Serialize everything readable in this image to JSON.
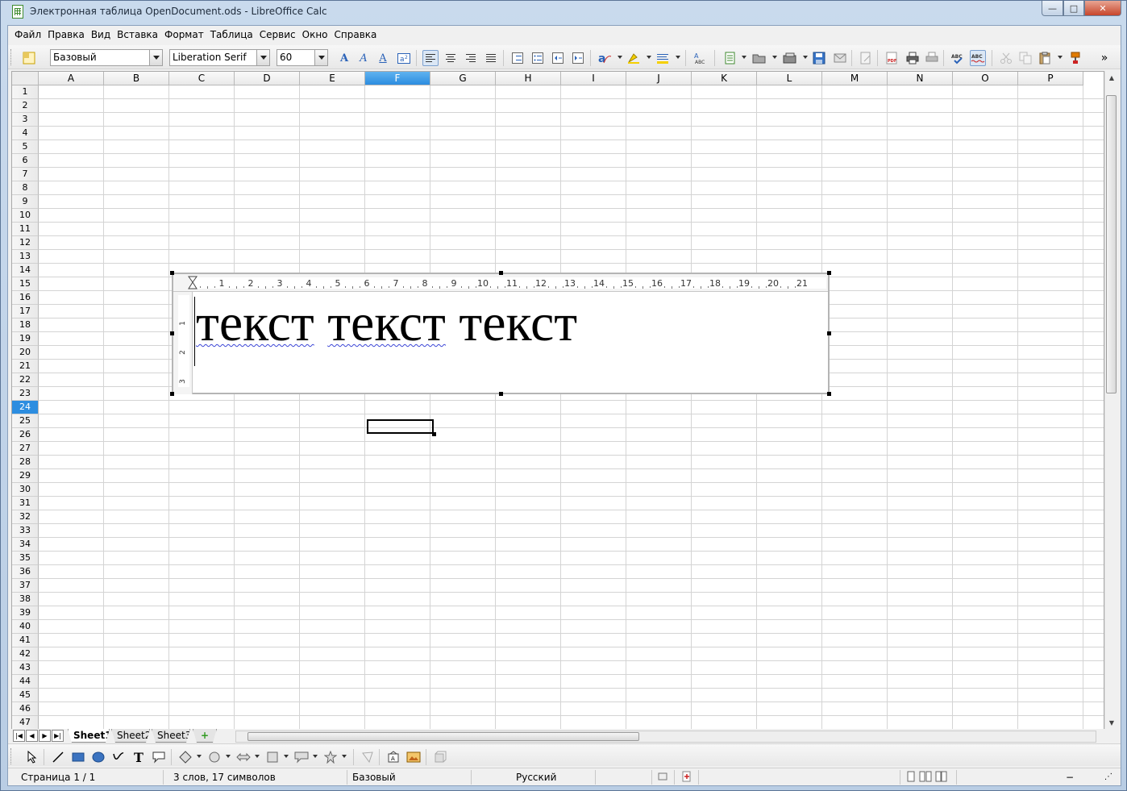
{
  "window": {
    "title": "Электронная таблица OpenDocument.ods - LibreOffice Calc",
    "min_glyph": "—",
    "max_glyph": "□",
    "close_glyph": "✕"
  },
  "menu": [
    "Файл",
    "Правка",
    "Вид",
    "Вставка",
    "Формат",
    "Таблица",
    "Сервис",
    "Окно",
    "Справка"
  ],
  "toolbar": {
    "paragraph_style": "Базовый",
    "font_name": "Liberation Serif",
    "font_size": "60",
    "overflow_glyph": "»"
  },
  "grid": {
    "columns": [
      "A",
      "B",
      "C",
      "D",
      "E",
      "F",
      "G",
      "H",
      "I",
      "J",
      "K",
      "L",
      "M",
      "N",
      "O",
      "P"
    ],
    "selected_column": "F",
    "rows": [
      "1",
      "2",
      "3",
      "4",
      "5",
      "6",
      "7",
      "8",
      "9",
      "10",
      "11",
      "12",
      "13",
      "14",
      "15",
      "16",
      "17",
      "18",
      "19",
      "20",
      "21",
      "22",
      "23",
      "24",
      "25",
      "26",
      "27",
      "28",
      "29",
      "30",
      "31",
      "32",
      "33",
      "34",
      "35",
      "36",
      "37",
      "38",
      "39",
      "40",
      "41",
      "42",
      "43",
      "44",
      "45",
      "46",
      "47"
    ],
    "selected_row": "24"
  },
  "text_frame": {
    "ruler_numbers": [
      "1",
      "2",
      "3",
      "4",
      "5",
      "6",
      "7",
      "8",
      "9",
      "10",
      "11",
      "12",
      "13",
      "14",
      "15",
      "16",
      "17",
      "18",
      "19",
      "20",
      "21"
    ],
    "vertical_ruler_numbers": [
      "1",
      "2",
      "3"
    ],
    "word1": "текст",
    "word2": "текст",
    "word3": "текст",
    "space": " "
  },
  "sheet_tabs": {
    "tabs": [
      "Sheet1",
      "Sheet2",
      "Sheet3"
    ],
    "active": "Sheet1",
    "add_glyph": "+"
  },
  "statusbar": {
    "page": "Страница 1 / 1",
    "word_count": "3 слов, 17 символов",
    "style": "Базовый",
    "language": "Русский"
  },
  "colors": {
    "selection": "#2c8de0",
    "title_bar": "#c9daed"
  }
}
